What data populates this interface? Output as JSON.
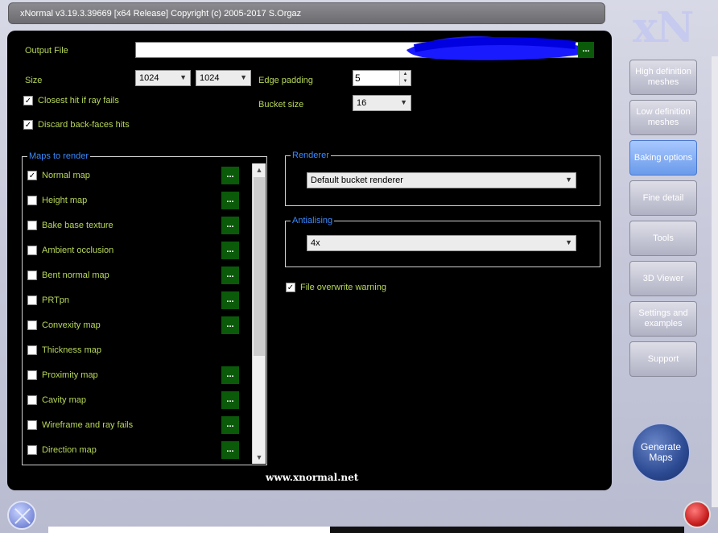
{
  "window": {
    "title": "xNormal v3.19.3.39669 [x64 Release] Copyright (c) 2005-2017 S.Orgaz",
    "logo": "xN"
  },
  "output": {
    "label": "Output File",
    "value": "",
    "browse_label": "..."
  },
  "size": {
    "label": "Size",
    "width": "1024",
    "height": "1024"
  },
  "edge_padding": {
    "label": "Edge padding",
    "value": "5"
  },
  "bucket_size": {
    "label": "Bucket size",
    "value": "16"
  },
  "options": {
    "closest_hit": {
      "label": "Closest hit if ray fails",
      "checked": true
    },
    "discard_backfaces": {
      "label": "Discard back-faces hits",
      "checked": true
    },
    "file_overwrite": {
      "label": "File overwrite warning",
      "checked": true
    }
  },
  "maps": {
    "title": "Maps to render",
    "items": [
      {
        "label": "Normal map",
        "checked": true,
        "has_options": true
      },
      {
        "label": "Height map",
        "checked": false,
        "has_options": true
      },
      {
        "label": "Bake base texture",
        "checked": false,
        "has_options": true
      },
      {
        "label": "Ambient occlusion",
        "checked": false,
        "has_options": true
      },
      {
        "label": "Bent normal map",
        "checked": false,
        "has_options": true
      },
      {
        "label": "PRTpn",
        "checked": false,
        "has_options": true
      },
      {
        "label": "Convexity map",
        "checked": false,
        "has_options": true
      },
      {
        "label": "Thickness map",
        "checked": false,
        "has_options": false
      },
      {
        "label": "Proximity map",
        "checked": false,
        "has_options": true
      },
      {
        "label": "Cavity map",
        "checked": false,
        "has_options": true
      },
      {
        "label": "Wireframe and ray fails",
        "checked": false,
        "has_options": true
      },
      {
        "label": "Direction map",
        "checked": false,
        "has_options": true
      }
    ],
    "options_label": "..."
  },
  "renderer": {
    "title": "Renderer",
    "value": "Default bucket renderer"
  },
  "antialiasing": {
    "title": "Antialising",
    "value": "4x"
  },
  "sidebar": {
    "items": [
      {
        "label": "High definition meshes",
        "active": false
      },
      {
        "label": "Low definition meshes",
        "active": false
      },
      {
        "label": "Baking options",
        "active": true
      },
      {
        "label": "Fine detail",
        "active": false
      },
      {
        "label": "Tools",
        "active": false
      },
      {
        "label": "3D Viewer",
        "active": false
      },
      {
        "label": "Settings and examples",
        "active": false
      },
      {
        "label": "Support",
        "active": false
      }
    ]
  },
  "generate": {
    "label": "Generate Maps"
  },
  "footer": {
    "url": "www.xnormal.net"
  },
  "colors": {
    "label_green": "#b8d858",
    "group_title_blue": "#3a8aff",
    "options_button": "#0a5a0a",
    "active_tab": "#6a9aea"
  }
}
